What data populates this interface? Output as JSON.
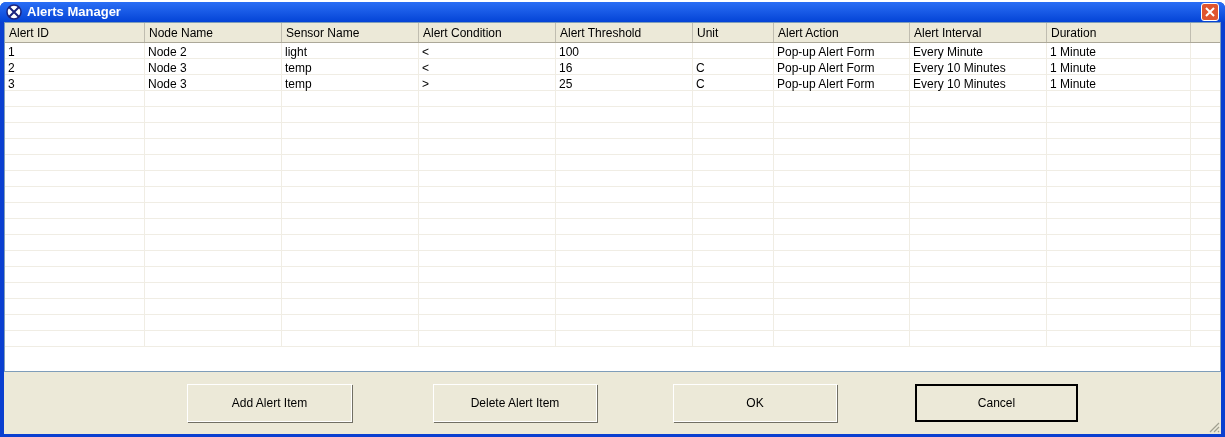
{
  "window": {
    "title": "Alerts Manager"
  },
  "table": {
    "columns": [
      "Alert ID",
      "Node Name",
      "Sensor Name",
      "Alert Condition",
      "Alert Threshold",
      "Unit",
      "Alert Action",
      "Alert Interval",
      "Duration"
    ],
    "rows": [
      [
        "1",
        "Node 2",
        "light",
        "<",
        "100",
        "",
        "Pop-up Alert Form",
        "Every Minute",
        "1 Minute"
      ],
      [
        "2",
        "Node 3",
        "temp",
        "<",
        "16",
        "C",
        "Pop-up Alert Form",
        "Every 10 Minutes",
        "1 Minute"
      ],
      [
        "3",
        "Node 3",
        "temp",
        ">",
        "25",
        "C",
        "Pop-up Alert Form",
        "Every 10 Minutes",
        "1 Minute"
      ]
    ]
  },
  "buttons": [
    {
      "label": "Add Alert Item",
      "default": false
    },
    {
      "label": "Delete Alert Item",
      "default": false
    },
    {
      "label": "OK",
      "default": false
    },
    {
      "label": "Cancel",
      "default": true
    }
  ]
}
